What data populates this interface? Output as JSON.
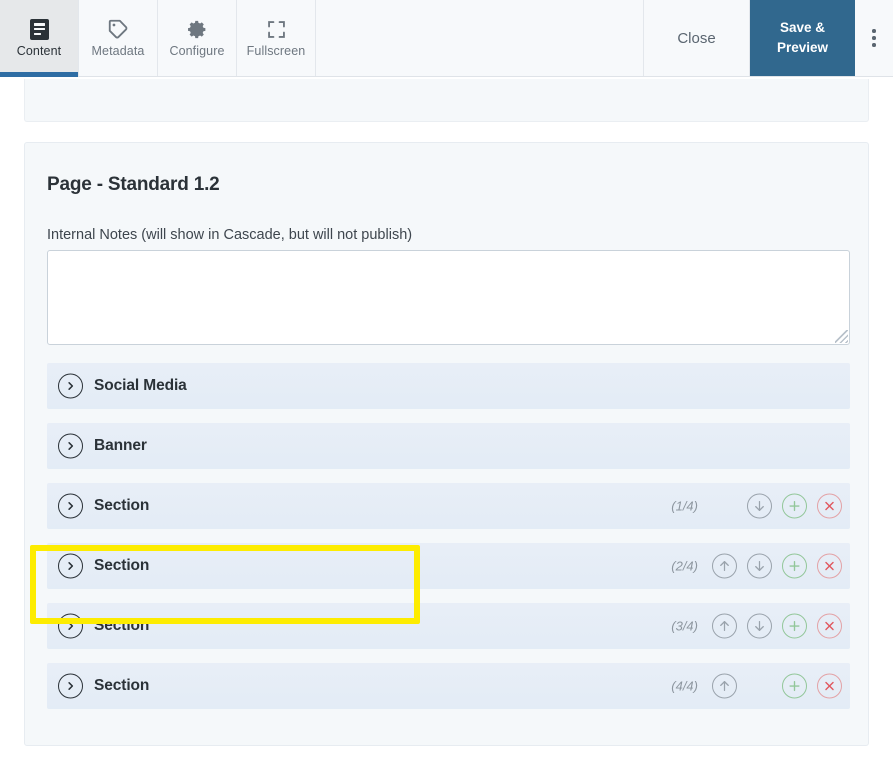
{
  "toolbar": {
    "tabs": [
      {
        "label": "Content",
        "icon": "document-icon",
        "active": true
      },
      {
        "label": "Metadata",
        "icon": "tag-icon",
        "active": false
      },
      {
        "label": "Configure",
        "icon": "gear-icon",
        "active": false
      },
      {
        "label": "Fullscreen",
        "icon": "fullscreen-icon",
        "active": false
      }
    ],
    "close_label": "Close",
    "save_label_line1": "Save &",
    "save_label_line2": "Preview",
    "kebab_icon": "more-vertical-icon",
    "save_color": "#31688e",
    "active_underline_color": "#2e6da4"
  },
  "card": {
    "title": "Page - Standard 1.2",
    "notes_label": "Internal Notes (will show in Cascade, but will not publish)",
    "notes_value": "",
    "notes_placeholder": ""
  },
  "rows": [
    {
      "label": "Social Media",
      "counter": "",
      "chevron": "chevron-right-icon",
      "up": false,
      "down": false,
      "add": false,
      "remove": false
    },
    {
      "label": "Banner",
      "counter": "",
      "chevron": "chevron-right-icon",
      "up": false,
      "down": false,
      "add": false,
      "remove": false
    },
    {
      "label": "Section",
      "counter": "(1/4)",
      "chevron": "chevron-right-icon",
      "up": false,
      "down": true,
      "add": true,
      "remove": true
    },
    {
      "label": "Section",
      "counter": "(2/4)",
      "chevron": "chevron-right-icon",
      "up": true,
      "down": true,
      "add": true,
      "remove": true
    },
    {
      "label": "Section",
      "counter": "(3/4)",
      "chevron": "chevron-right-icon",
      "up": true,
      "down": true,
      "add": true,
      "remove": true
    },
    {
      "label": "Section",
      "counter": "(4/4)",
      "chevron": "chevron-right-icon",
      "up": true,
      "down": false,
      "add": true,
      "remove": true
    }
  ],
  "highlight": {
    "color": "#fdec00",
    "target_row_index": 2,
    "target_row_label": "Section"
  },
  "colors": {
    "row_background": "#e8eef7",
    "card_background": "#f5f8fa",
    "toolbar_background": "#f7f9fb",
    "text_primary": "#2b3238",
    "text_muted": "#8d969f",
    "add_icon": "#93c79a",
    "remove_icon": "#e3a2a6"
  }
}
